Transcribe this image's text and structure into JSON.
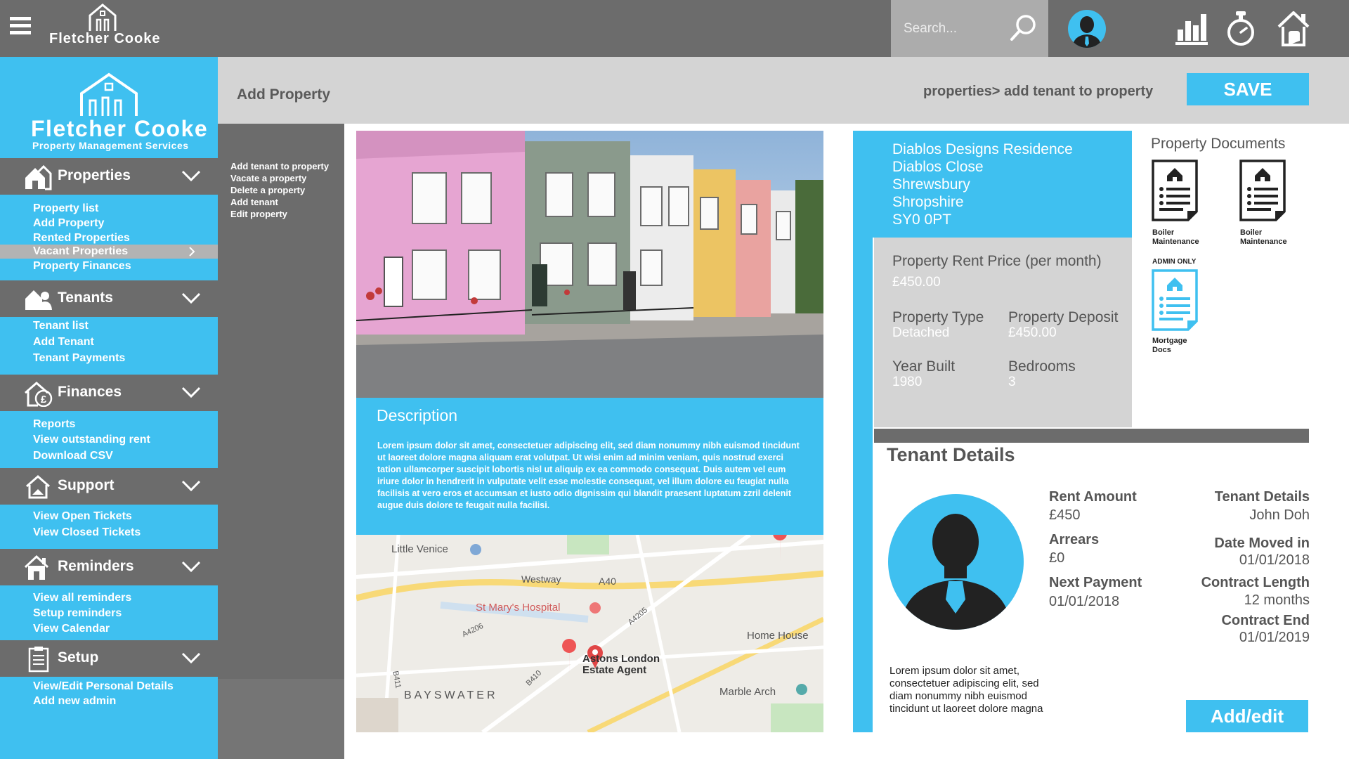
{
  "app": {
    "brand": "Fletcher Cooke",
    "brand_sub": "Property Management Services"
  },
  "topbar": {
    "search_placeholder": "Search..."
  },
  "sidebar": {
    "sections": [
      {
        "label": "Properties",
        "items": [
          "Property list",
          "Add Property",
          "Rented Properties",
          "Vacant Properties",
          "Property Finances"
        ],
        "active_item": "Vacant Properties"
      },
      {
        "label": "Tenants",
        "items": [
          "Tenant list",
          "Add Tenant",
          "Tenant Payments"
        ]
      },
      {
        "label": "Finances",
        "items": [
          "Reports",
          "View outstanding rent",
          "Download CSV"
        ]
      },
      {
        "label": "Support",
        "items": [
          "View Open Tickets",
          "View Closed Tickets"
        ]
      },
      {
        "label": "Reminders",
        "items": [
          "View all reminders",
          "Setup reminders",
          "View Calendar"
        ]
      },
      {
        "label": "Setup",
        "items": [
          "View/Edit Personal Details",
          "Add new admin"
        ]
      }
    ]
  },
  "actions": [
    "Add tenant to property",
    "Vacate a property",
    "Delete a property",
    "Add tenant",
    "Edit property"
  ],
  "header": {
    "title": "Add Property",
    "breadcrumb": "properties> add tenant to property",
    "save_label": "SAVE"
  },
  "description": {
    "heading": "Description",
    "text": "Lorem ipsum dolor sit amet, consectetuer adipiscing elit, sed diam nonummy nibh euismod tincidunt ut laoreet dolore magna aliquam erat volutpat. Ut wisi enim ad minim veniam, quis nostrud exerci tation ullamcorper suscipit lobortis nisl ut aliquip ex ea commodo consequat. Duis autem vel eum iriure dolor in hendrerit in vulputate velit esse molestie consequat, vel illum dolore eu feugiat nulla facilisis at vero eros et accumsan et iusto odio dignissim qui blandit praesent luptatum zzril delenit augue duis dolore te feugait nulla facilisi."
  },
  "map": {
    "labels": [
      "Little Venice",
      "Westway",
      "A40",
      "St Mary's Hospital",
      "A4205",
      "A4206",
      "Home House",
      "Astons London",
      "Estate Agent",
      "B411",
      "B410",
      "BAYSWATER",
      "Marble Arch"
    ]
  },
  "property": {
    "address": [
      "Diablos Designs Residence",
      "Diablos Close",
      "Shrewsbury",
      "Shropshire",
      "SY0 0PT"
    ],
    "rent_label": "Property Rent Price (per month)",
    "rent_value": "£450.00",
    "type_label": "Property Type",
    "type_value": "Detached",
    "deposit_label": "Property Deposit",
    "deposit_value": "£450.00",
    "year_label": "Year Built",
    "year_value": "1980",
    "bedrooms_label": "Bedrooms",
    "bedrooms_value": "3"
  },
  "documents": {
    "title": "Property Documents",
    "admin_only": "ADMIN ONLY",
    "docs": [
      {
        "label1": "Boiler",
        "label2": "Maintenance"
      },
      {
        "label1": "Boiler",
        "label2": "Maintenance"
      },
      {
        "label1": "Mortgage",
        "label2": "Docs"
      }
    ]
  },
  "tenant": {
    "title": "Tenant Details",
    "rent_label": "Rent Amount",
    "rent_value": "£450",
    "arrears_label": "Arrears",
    "arrears_value": "£0",
    "next_label": "Next Payment",
    "next_value": "01/01/2018",
    "details_label": "Tenant Details",
    "details_value": "John Doh",
    "moved_label": "Date Moved in",
    "moved_value": "01/01/2018",
    "length_label": "Contract Length",
    "length_value": "12 months",
    "end_label": "Contract End",
    "end_value": "01/01/2019",
    "bio": "Lorem ipsum dolor sit amet, consectetuer adipiscing elit, sed diam nonummy nibh euismod tincidunt ut laoreet dolore magna",
    "add_label": "Add/edit"
  },
  "colors": {
    "accent": "#3fc0f0",
    "dark": "#6c6c6c",
    "light": "#d4d4d4"
  }
}
